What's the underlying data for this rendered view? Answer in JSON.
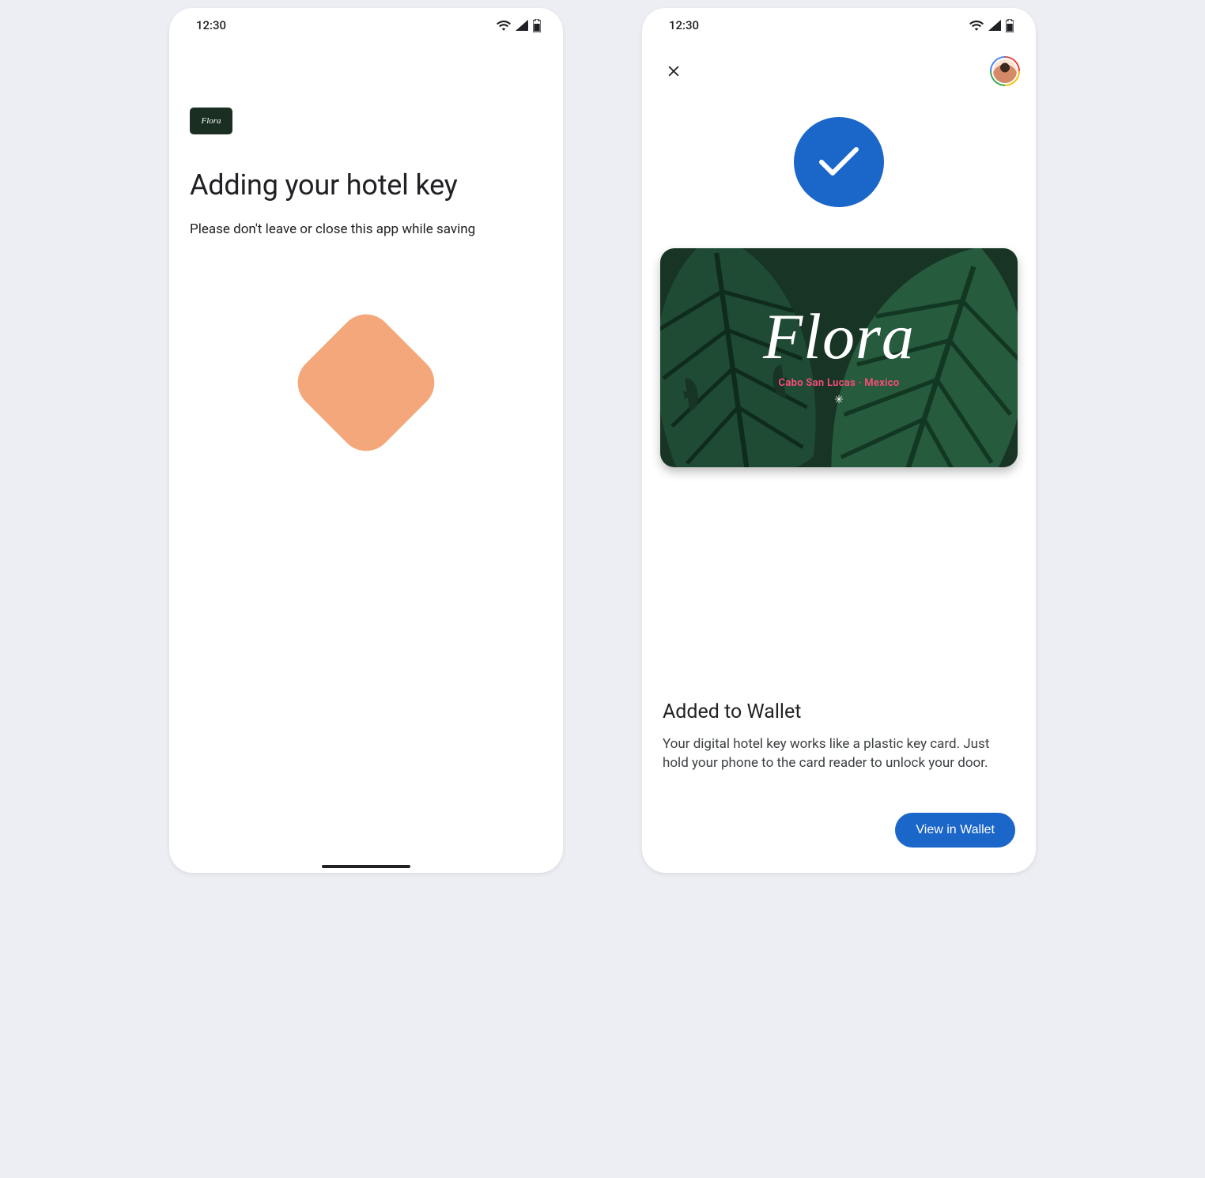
{
  "statusBar": {
    "time": "12:30"
  },
  "leftScreen": {
    "brandNameMini": "Flora",
    "heading": "Adding your hotel key",
    "subtext": "Please don't leave or close this app while saving"
  },
  "rightScreen": {
    "card": {
      "brandName": "Flora",
      "subline": "Cabo San Lucas · Mexico",
      "symbol": "✳"
    },
    "resultHeading": "Added to Wallet",
    "resultBody": "Your digital hotel key works like a plastic key card. Just hold your phone to the card reader to unlock your door.",
    "viewButton": "View in Wallet"
  }
}
